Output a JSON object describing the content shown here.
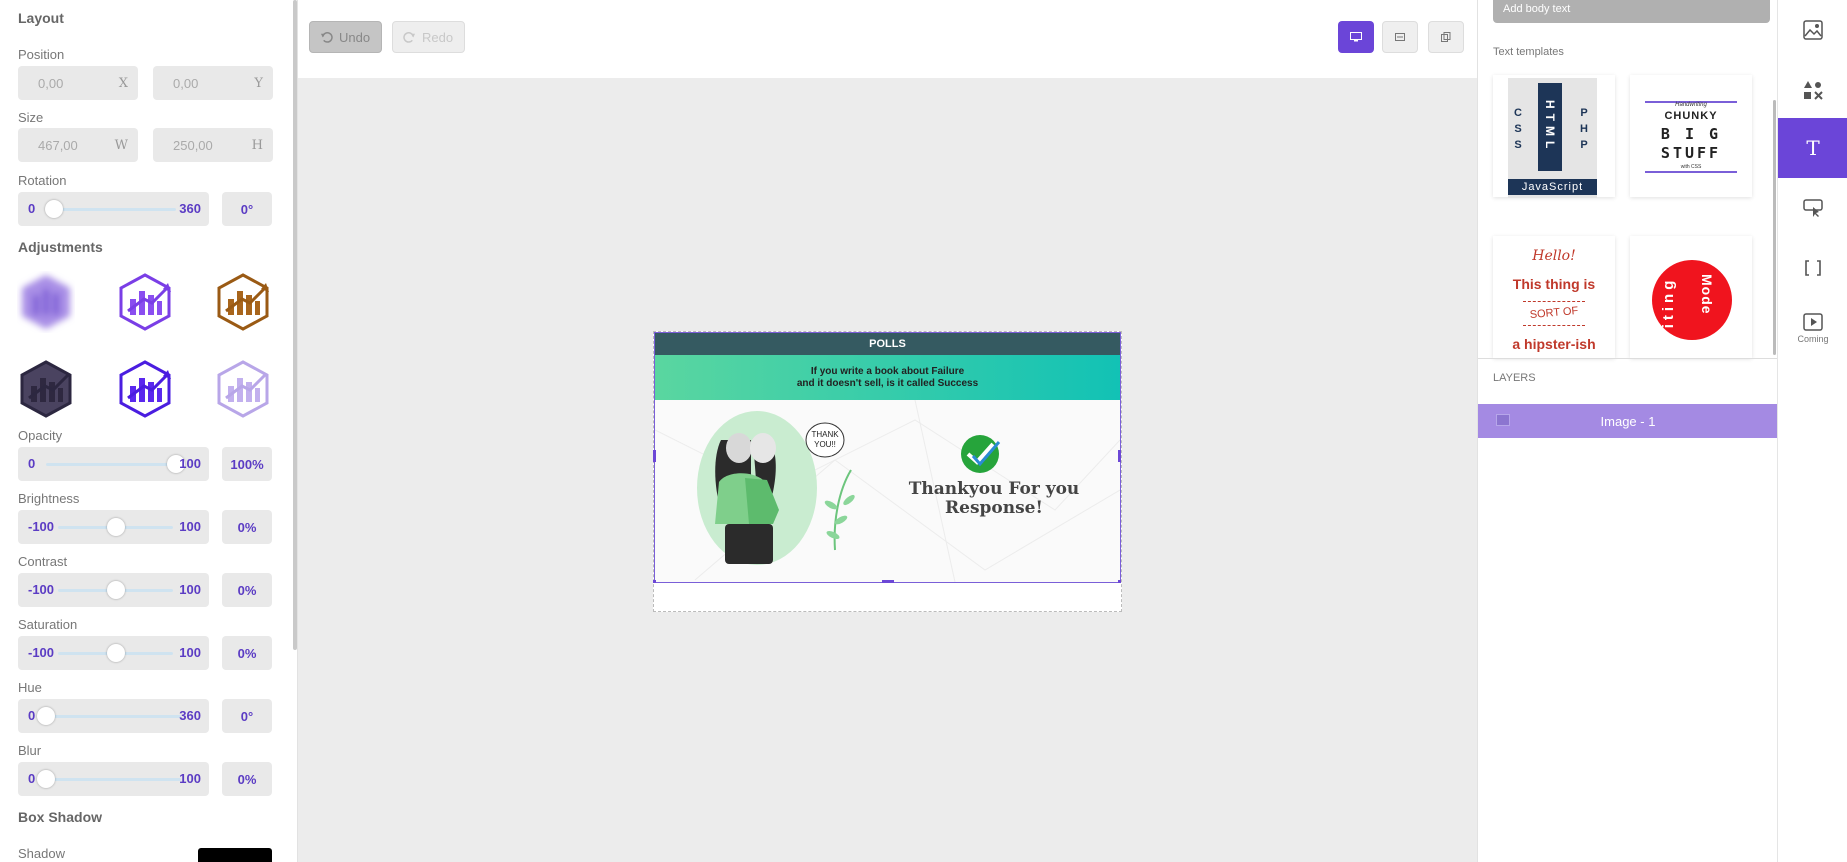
{
  "layout": {
    "title": "Layout",
    "position_label": "Position",
    "x_value": "0,00",
    "x_suffix": "X",
    "y_value": "0,00",
    "y_suffix": "Y",
    "size_label": "Size",
    "w_value": "467,00",
    "w_suffix": "W",
    "h_value": "250,00",
    "h_suffix": "H",
    "rotation_label": "Rotation",
    "rotation_min": "0",
    "rotation_max": "360",
    "rotation_value": "0°"
  },
  "adjustments": {
    "title": "Adjustments",
    "opacity": {
      "label": "Opacity",
      "min": "0",
      "max": "100",
      "value": "100%",
      "level": 1.0
    },
    "brightness": {
      "label": "Brightness",
      "min": "-100",
      "max": "100",
      "value": "0%",
      "level": 0.5
    },
    "contrast": {
      "label": "Contrast",
      "min": "-100",
      "max": "100",
      "value": "0%",
      "level": 0.5
    },
    "saturation": {
      "label": "Saturation",
      "min": "-100",
      "max": "100",
      "value": "0%",
      "level": 0.5
    },
    "hue": {
      "label": "Hue",
      "min": "0",
      "max": "360",
      "value": "0°",
      "level": 0.0
    },
    "blur": {
      "label": "Blur",
      "min": "0",
      "max": "100",
      "value": "0%",
      "level": 0.0
    }
  },
  "box_shadow": {
    "title": "Box Shadow",
    "shadow_label": "Shadow",
    "shadow_color": "#000000"
  },
  "toolbar": {
    "undo": "Undo",
    "redo": "Redo"
  },
  "canvas": {
    "header": "POLLS",
    "band_line1": "If you write a book about Failure",
    "band_line2": "and it doesn't sell, is it called Success",
    "bubble_line1": "THANK",
    "bubble_line2": "YOU!!",
    "thanks_line1": "Thankyou For you",
    "thanks_line2": "Response!"
  },
  "right_panel": {
    "add_body_text": "Add body text",
    "text_templates_label": "Text templates",
    "tpl1": {
      "left": "C\nS\nS",
      "center": "HTML",
      "right": "P\nH\nP",
      "footer": "JavaScript"
    },
    "tpl2": {
      "top": "Handwriting",
      "line1": "CHUNKY",
      "line2": "B I G",
      "line3": "STUFF",
      "bottom": "with CSS"
    },
    "tpl3": {
      "line1": "Hello!",
      "line2": "This thing is",
      "line3": "SORT OF",
      "line4": "a hipster-ish"
    },
    "tpl4": {
      "word1": "Writing",
      "word2": "Mode"
    },
    "layers_label": "LAYERS",
    "layer_name": "Image - 1"
  },
  "rail": {
    "coming": "Coming"
  },
  "colors": {
    "accent": "#6b45d8",
    "accent_text": "#5b3cc4"
  }
}
